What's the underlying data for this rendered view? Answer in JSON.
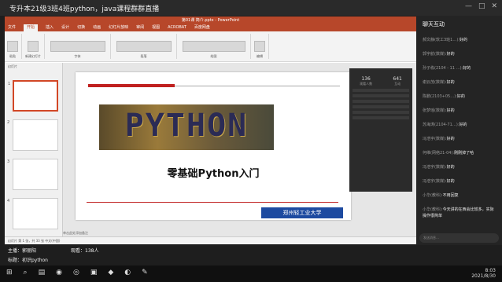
{
  "live": {
    "title": "专升本21级3班4班python，java课程群群直播",
    "controls": [
      "—",
      "□",
      "✕"
    ]
  },
  "ppt": {
    "window_title": "第01课 简介.pptx - PowerPoint",
    "menu": [
      "文件",
      "开始",
      "插入",
      "设计",
      "切换",
      "动画",
      "幻灯片放映",
      "审阅",
      "视图",
      "ACROBAT",
      "百度网盘"
    ],
    "ribbon": [
      "粘贴",
      "新建幻灯片",
      "字体",
      "段落",
      "绘图",
      "编辑"
    ],
    "thumbs_header": "幻灯片",
    "slide_numbers": [
      "1",
      "2",
      "3",
      "4"
    ],
    "slide": {
      "banner": "PYTHON",
      "title": "零基础Python入门",
      "logo": "郑州轻工业大学"
    },
    "notes": "单击此处添加备注",
    "status": "幻灯片 第 1 张，共 33 张  中文(中国)"
  },
  "camera": {
    "count_a": "136",
    "label_a": "观看人数",
    "count_b": "641",
    "label_b": "互动"
  },
  "chat": {
    "title": "聊天互动",
    "messages": [
      {
        "user": "郝文静(软工3班1…):",
        "text": "好的"
      },
      {
        "user": "郭宇航(数媒):",
        "text": "好的"
      },
      {
        "user": "孙子栋(2104 - 11 …):",
        "text": "好的"
      },
      {
        "user": "谢云茂(数媒):",
        "text": "好的"
      },
      {
        "user": "陈鹏(2103+05…):",
        "text": "好的"
      },
      {
        "user": "张梦瑶(数媒):",
        "text": "好的"
      },
      {
        "user": "苏海涛(2104-71…):",
        "text": "好的"
      },
      {
        "user": "冯浩宇(数媒):",
        "text": "好的"
      },
      {
        "user": "何维(网络21-04):",
        "text": "刚刚掉了哈"
      },
      {
        "user": "冯浩宇(数媒):",
        "text": "好的"
      },
      {
        "user": "冯浩宇(数媒):",
        "text": "好的"
      },
      {
        "user": "小华(教科):",
        "text": "不用回复"
      },
      {
        "user": "小华(教科):",
        "text": "今天讲的在西会比较多，实际操作很简单"
      }
    ],
    "input_placeholder": "发送消息…"
  },
  "info": {
    "host": "主播：郭丽阳",
    "viewers": "观看：138人",
    "topic": "标题：初识python"
  },
  "taskbar": {
    "icons": [
      "⊞",
      "⌕",
      "▤",
      "◉",
      "◎",
      "▣",
      "◆",
      "◐",
      "✎"
    ],
    "time": "8:03",
    "date": "2021/8/30"
  }
}
